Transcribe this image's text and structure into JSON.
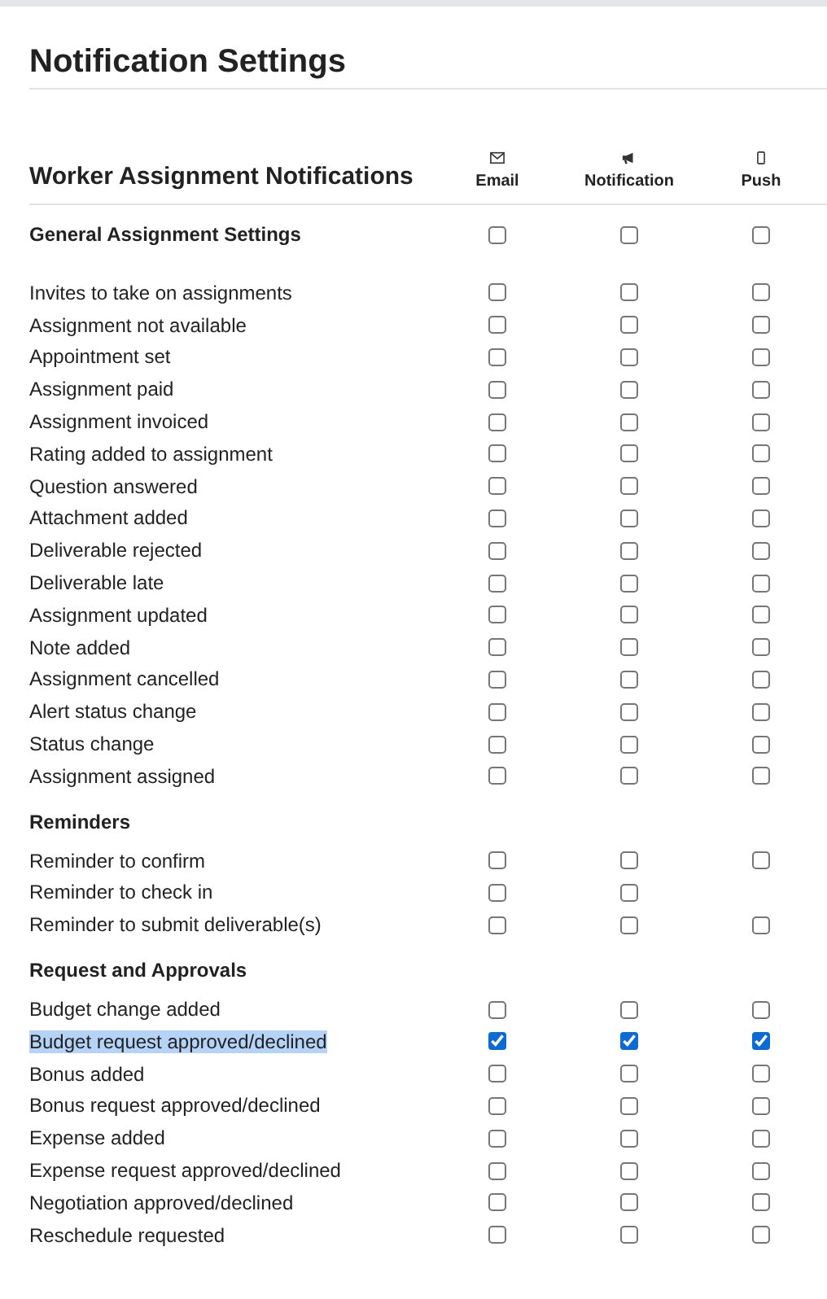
{
  "title": "Notification Settings",
  "table": {
    "heading": "Worker Assignment Notifications",
    "columns": [
      {
        "kind": "email",
        "label": "Email"
      },
      {
        "kind": "notification",
        "label": "Notification"
      },
      {
        "kind": "push",
        "label": "Push"
      }
    ],
    "sections": [
      {
        "title": "General Assignment Settings",
        "checks": {
          "email": false,
          "notification": false,
          "push": false
        },
        "rows": [
          {
            "label": "Invites to take on assignments",
            "highlighted": false,
            "email": false,
            "notification": false,
            "push": false
          },
          {
            "label": "Assignment not available",
            "highlighted": false,
            "email": false,
            "notification": false,
            "push": false
          },
          {
            "label": "Appointment set",
            "highlighted": false,
            "email": false,
            "notification": false,
            "push": false
          },
          {
            "label": "Assignment paid",
            "highlighted": false,
            "email": false,
            "notification": false,
            "push": false
          },
          {
            "label": "Assignment invoiced",
            "highlighted": false,
            "email": false,
            "notification": false,
            "push": false
          },
          {
            "label": "Rating added to assignment",
            "highlighted": false,
            "email": false,
            "notification": false,
            "push": false
          },
          {
            "label": "Question answered",
            "highlighted": false,
            "email": false,
            "notification": false,
            "push": false
          },
          {
            "label": "Attachment added",
            "highlighted": false,
            "email": false,
            "notification": false,
            "push": false
          },
          {
            "label": "Deliverable rejected",
            "highlighted": false,
            "email": false,
            "notification": false,
            "push": false
          },
          {
            "label": "Deliverable late",
            "highlighted": false,
            "email": false,
            "notification": false,
            "push": false
          },
          {
            "label": "Assignment updated",
            "highlighted": false,
            "email": false,
            "notification": false,
            "push": false
          },
          {
            "label": "Note added",
            "highlighted": false,
            "email": false,
            "notification": false,
            "push": false
          },
          {
            "label": "Assignment cancelled",
            "highlighted": false,
            "email": false,
            "notification": false,
            "push": false
          },
          {
            "label": "Alert status change",
            "highlighted": false,
            "email": false,
            "notification": false,
            "push": false
          },
          {
            "label": "Status change",
            "highlighted": false,
            "email": false,
            "notification": false,
            "push": false
          },
          {
            "label": "Assignment assigned",
            "highlighted": false,
            "email": false,
            "notification": false,
            "push": false
          }
        ]
      },
      {
        "title": "Reminders",
        "rows": [
          {
            "label": "Reminder to confirm",
            "highlighted": false,
            "email": false,
            "notification": false,
            "push": false
          },
          {
            "label": "Reminder to check in",
            "highlighted": false,
            "email": false,
            "notification": false
          },
          {
            "label": "Reminder to submit deliverable(s)",
            "highlighted": false,
            "email": false,
            "notification": false,
            "push": false
          }
        ]
      },
      {
        "title": "Request and Approvals",
        "rows": [
          {
            "label": "Budget change added",
            "highlighted": false,
            "email": false,
            "notification": false,
            "push": false
          },
          {
            "label": "Budget request approved/declined",
            "highlighted": true,
            "email": true,
            "notification": true,
            "push": true
          },
          {
            "label": "Bonus added",
            "highlighted": false,
            "email": false,
            "notification": false,
            "push": false
          },
          {
            "label": "Bonus request approved/declined",
            "highlighted": false,
            "email": false,
            "notification": false,
            "push": false
          },
          {
            "label": "Expense added",
            "highlighted": false,
            "email": false,
            "notification": false,
            "push": false
          },
          {
            "label": "Expense request approved/declined",
            "highlighted": false,
            "email": false,
            "notification": false,
            "push": false
          },
          {
            "label": "Negotiation approved/declined",
            "highlighted": false,
            "email": false,
            "notification": false,
            "push": false
          },
          {
            "label": "Reschedule requested",
            "highlighted": false,
            "email": false,
            "notification": false,
            "push": false
          }
        ]
      }
    ]
  }
}
